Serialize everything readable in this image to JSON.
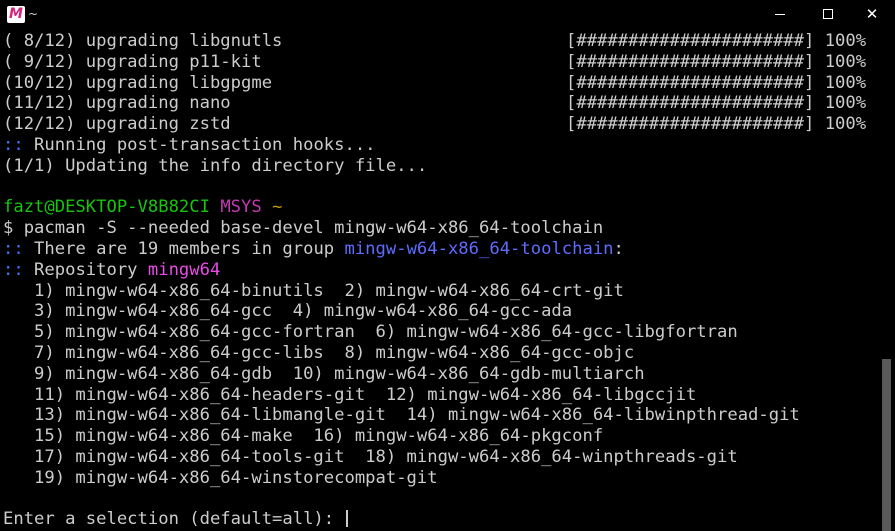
{
  "window": {
    "app_icon_letter": "M",
    "title": "~",
    "minimize_icon": "minimize-icon",
    "maximize_icon": "maximize-icon",
    "close_icon": "close-icon",
    "close_glyph": "✕"
  },
  "colors": {
    "background": "#000000",
    "text": "#cccccc",
    "prompt_user": "#16c60c",
    "prompt_msys": "#c239b3",
    "prefix_marker": "#3b78ff",
    "group_name": "#5e6bff",
    "repo_name": "#e74ce6"
  },
  "terminal": {
    "upgrades": [
      {
        "text": "( 8/12) upgrading libgnutls",
        "bar": "[######################] 100%"
      },
      {
        "text": "( 9/12) upgrading p11-kit",
        "bar": "[######################] 100%"
      },
      {
        "text": "(10/12) upgrading libgpgme",
        "bar": "[######################] 100%"
      },
      {
        "text": "(11/12) upgrading nano",
        "bar": "[######################] 100%"
      },
      {
        "text": "(12/12) upgrading zstd",
        "bar": "[######################] 100%"
      }
    ],
    "hooks_marker": "::",
    "hooks_text": " Running post-transaction hooks...",
    "updating_text": "(1/1) Updating the info directory file...",
    "prompt_user": "fazt@DESKTOP-V8B82CI",
    "prompt_env": "MSYS",
    "prompt_dir": "~",
    "command": "$ pacman -S --needed base-devel mingw-w64-x86_64-toolchain",
    "members_marker": "::",
    "members_text": " There are 19 members in group ",
    "members_group": "mingw-w64-x86_64-toolchain",
    "members_suffix": ":",
    "repo_marker": "::",
    "repo_label": " Repository ",
    "repo_name": "mingw64",
    "package_lines": [
      "   1) mingw-w64-x86_64-binutils  2) mingw-w64-x86_64-crt-git",
      "   3) mingw-w64-x86_64-gcc  4) mingw-w64-x86_64-gcc-ada",
      "   5) mingw-w64-x86_64-gcc-fortran  6) mingw-w64-x86_64-gcc-libgfortran",
      "   7) mingw-w64-x86_64-gcc-libs  8) mingw-w64-x86_64-gcc-objc",
      "   9) mingw-w64-x86_64-gdb  10) mingw-w64-x86_64-gdb-multiarch",
      "   11) mingw-w64-x86_64-headers-git  12) mingw-w64-x86_64-libgccjit",
      "   13) mingw-w64-x86_64-libmangle-git  14) mingw-w64-x86_64-libwinpthread-git",
      "   15) mingw-w64-x86_64-make  16) mingw-w64-x86_64-pkgconf",
      "   17) mingw-w64-x86_64-tools-git  18) mingw-w64-x86_64-winpthreads-git",
      "   19) mingw-w64-x86_64-winstorecompat-git"
    ],
    "selection_prompt": "Enter a selection (default=all): "
  }
}
